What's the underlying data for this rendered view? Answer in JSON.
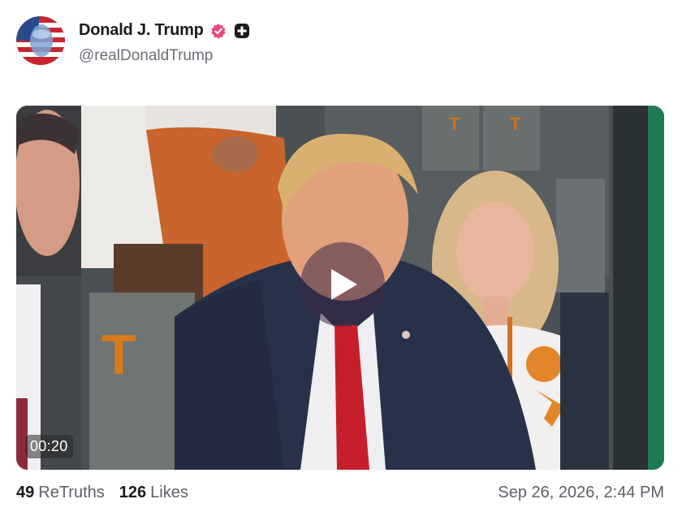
{
  "post": {
    "author": {
      "display_name": "Donald J. Trump",
      "handle": "@realDonaldTrump",
      "verified_icon": "verified-badge-icon",
      "verified_color": "#e6497d",
      "extra_badge_icon": "plus-badge-icon"
    },
    "video": {
      "duration": "00:20",
      "play_icon": "play-icon"
    },
    "stats": {
      "retruths_count": "49",
      "retruths_label": "ReTruths",
      "likes_count": "126",
      "likes_label": "Likes"
    },
    "timestamp": "Sep 26, 2026, 2:44 PM"
  }
}
